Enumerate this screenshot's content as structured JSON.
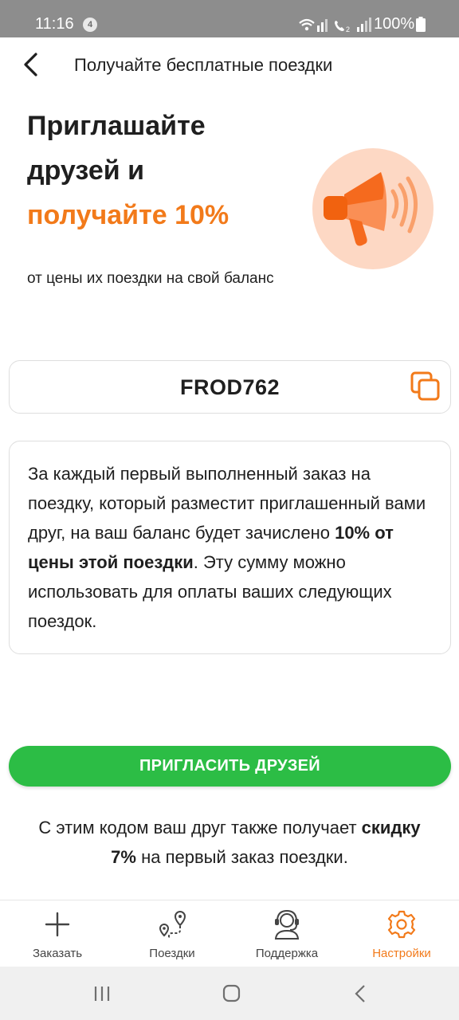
{
  "status_bar": {
    "time": "11:16",
    "notification_count": "4",
    "battery": "100%"
  },
  "header": {
    "title": "Получайте бесплатные поездки"
  },
  "hero": {
    "title_line1": "Приглашайте",
    "title_line2": "друзей и",
    "title_accent": "получайте 10%",
    "subtitle": "от цены их поездки на свой баланс",
    "illustration_icon": "megaphone-icon"
  },
  "promo": {
    "code": "FROD762",
    "copy_icon": "copy-icon"
  },
  "info": {
    "part1": "За каждый первый выполненный заказ на поездку, который разместит приглашенный вами друг, на ваш баланс будет зачислено ",
    "bold": "10% от цены этой поездки",
    "part2": ". Эту сумму можно использовать для оплаты ваших следующих поездок."
  },
  "invite_button": "ПРИГЛАСИТЬ ДРУЗЕЙ",
  "friend_note": {
    "part1": "С этим кодом ваш друг также получает ",
    "bold": "скидку 7%",
    "part2": " на первый заказ поездки."
  },
  "bottom_nav": [
    {
      "label": "Заказать",
      "icon": "plus-icon"
    },
    {
      "label": "Поездки",
      "icon": "route-icon"
    },
    {
      "label": "Поддержка",
      "icon": "support-headset-icon"
    },
    {
      "label": "Настройки",
      "icon": "gear-icon",
      "active": true
    }
  ],
  "colors": {
    "accent": "#f27a1a",
    "button_green": "#2cbd45",
    "text": "#1f1f1f",
    "status_bar": "#8d8d8d"
  }
}
